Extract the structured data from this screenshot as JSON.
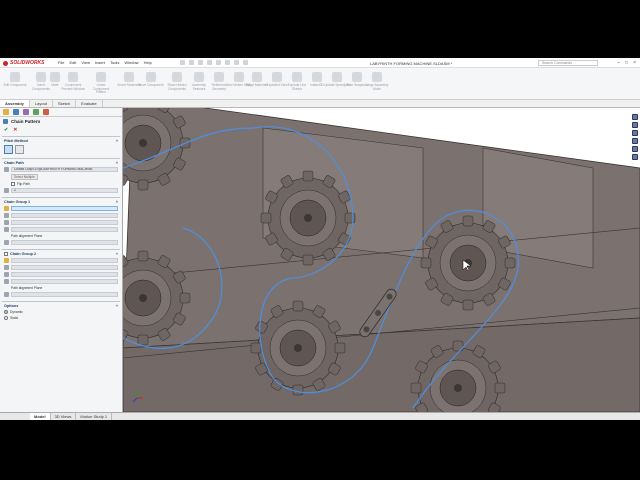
{
  "app": {
    "logo_text": "SOLIDWORKS",
    "document_title": "LABYRINTH FORMING MACHINE.SLDASM *",
    "search_placeholder": "Search Commands"
  },
  "menu": [
    "File",
    "Edit",
    "View",
    "Insert",
    "Tools",
    "Window",
    "Help"
  ],
  "ribbon": [
    "Edit Component",
    "Insert Components",
    "Mate",
    "Component Preview Window",
    "Linear Component Pattern",
    "Smart Fasteners",
    "Move Component",
    "Show Hidden Components",
    "Assembly Features",
    "Reference Geometry",
    "New Motion Study",
    "Bill of Materials",
    "Exploded View",
    "Explode Line Sketch",
    "Instant3D",
    "Update Speedpak",
    "Take Snapshot",
    "Large Assembly Mode"
  ],
  "command_tabs": [
    "Assembly",
    "Layout",
    "Sketch",
    "Evaluate"
  ],
  "property_manager": {
    "title": "Chain Pattern",
    "pitch_method": {
      "label": "Pitch Method"
    },
    "chain_path": {
      "label": "Chain Path",
      "value": "Closed Loop<1>@LABYRINTH FORMING MACHINE",
      "select_button": "Select Multiple",
      "flip_label": "Flip Path",
      "instances": "2"
    },
    "chain_group1": {
      "label": "Chain Group 1",
      "path_alignment": "Path alignment Plane"
    },
    "chain_group2": {
      "label": "Chain Group 2",
      "path_alignment": "Path alignment Plane"
    },
    "options": {
      "label": "Options",
      "dynamic": "Dynamic",
      "static": "Static"
    }
  },
  "bottom_tabs": [
    "Model",
    "3D Views",
    "Motion Study 1"
  ],
  "colors": {
    "path_line": "#4d8fe0",
    "part_face": "#7b7270",
    "part_dark": "#5f5654",
    "accent": "#d0202a"
  }
}
